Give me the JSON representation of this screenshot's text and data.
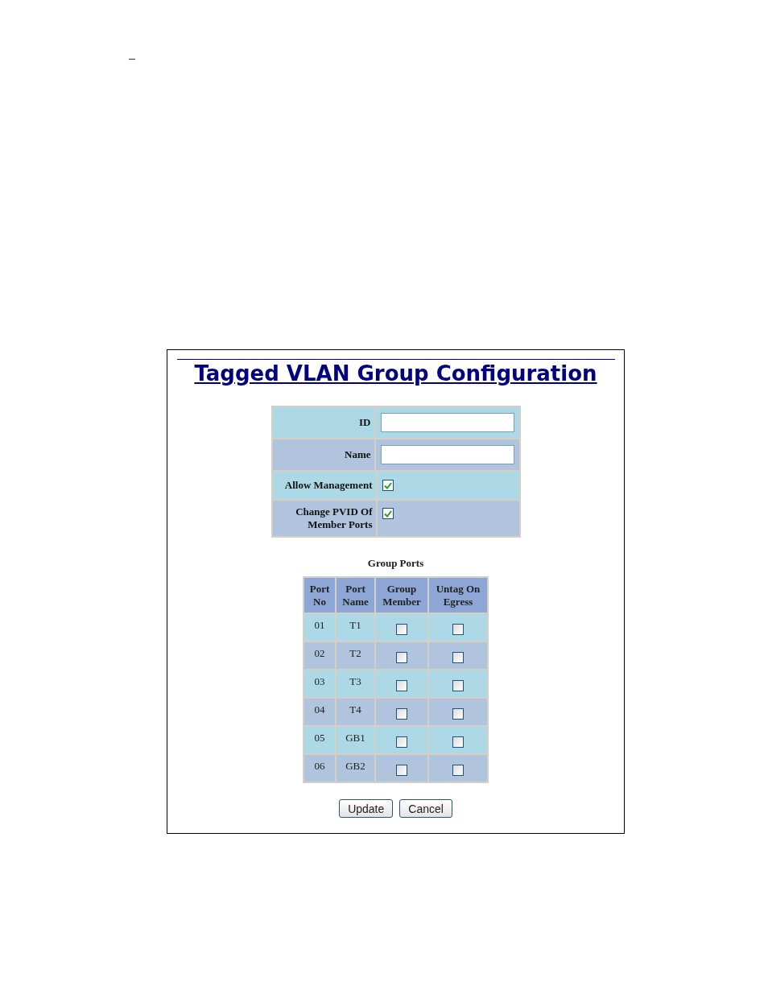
{
  "header_mark": "–",
  "title": "Tagged VLAN Group Configuration",
  "form": [
    {
      "kind": "text",
      "label": "ID"
    },
    {
      "kind": "text",
      "label": "Name"
    },
    {
      "kind": "checkbox",
      "label": "Allow Management",
      "checked": true
    },
    {
      "kind": "checkbox",
      "label": "Change PVID Of Member Ports",
      "checked": true
    }
  ],
  "group_ports": {
    "caption": "Group Ports",
    "columns": [
      "Port No",
      "Port Name",
      "Group Member",
      "Untag On Egress"
    ],
    "rows": [
      {
        "port_no": "01",
        "port_name": "T1",
        "group_member": false,
        "untag_on_egress": false
      },
      {
        "port_no": "02",
        "port_name": "T2",
        "group_member": false,
        "untag_on_egress": false
      },
      {
        "port_no": "03",
        "port_name": "T3",
        "group_member": false,
        "untag_on_egress": false
      },
      {
        "port_no": "04",
        "port_name": "T4",
        "group_member": false,
        "untag_on_egress": false
      },
      {
        "port_no": "05",
        "port_name": "GB1",
        "group_member": false,
        "untag_on_egress": false
      },
      {
        "port_no": "06",
        "port_name": "GB2",
        "group_member": false,
        "untag_on_egress": false
      }
    ]
  },
  "buttons": [
    "Update",
    "Cancel"
  ]
}
